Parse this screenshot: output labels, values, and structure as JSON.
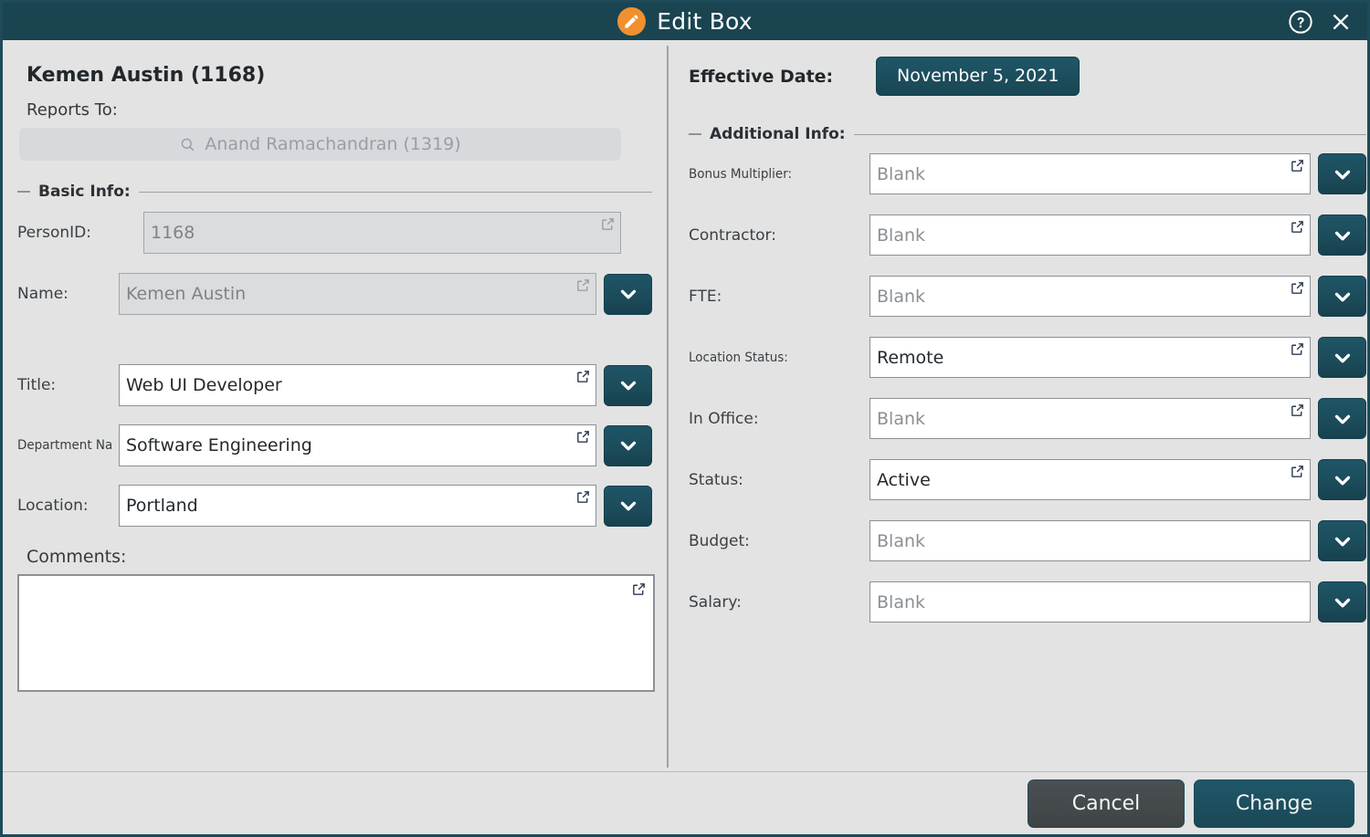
{
  "window": {
    "title": "Edit Box",
    "pencil_icon": "pencil-icon",
    "help_icon": "help-circle-icon",
    "close_icon": "close-icon",
    "accent_color": "#1a4450",
    "background_color": "#e3e3e3",
    "badge_color": "#f0902f"
  },
  "left": {
    "person_title": "Kemen Austin (1168)",
    "reports_to_label": "Reports To:",
    "reports_to_value": "Anand Ramachandran (1319)",
    "search_icon": "search-icon",
    "basic_info_header": "Basic Info:",
    "fields": [
      {
        "label": "PersonID:",
        "value": "1168",
        "disabled": true,
        "dropdown": false,
        "expand": true,
        "placeholder": false
      },
      {
        "label": "Name:",
        "value": "Kemen Austin",
        "disabled": true,
        "dropdown": true,
        "expand": true,
        "placeholder": false
      },
      {
        "label": "Title:",
        "value": "Web UI Developer",
        "disabled": false,
        "dropdown": true,
        "expand": true,
        "placeholder": false
      },
      {
        "label": "Department Name:",
        "value": "Software Engineering",
        "disabled": false,
        "dropdown": true,
        "expand": true,
        "placeholder": false
      },
      {
        "label": "Location:",
        "value": "Portland",
        "disabled": false,
        "dropdown": true,
        "expand": true,
        "placeholder": false
      }
    ],
    "comments_label": "Comments:",
    "comments_value": ""
  },
  "right": {
    "effective_date_label": "Effective Date:",
    "effective_date_value": "November 5, 2021",
    "additional_info_header": "Additional Info:",
    "fields": [
      {
        "label": "Bonus Multiplier:",
        "value": "Blank",
        "placeholder": true,
        "dropdown": true,
        "expand": true
      },
      {
        "label": "Contractor:",
        "value": "Blank",
        "placeholder": true,
        "dropdown": true,
        "expand": true
      },
      {
        "label": "FTE:",
        "value": "Blank",
        "placeholder": true,
        "dropdown": true,
        "expand": true
      },
      {
        "label": "Location Status:",
        "value": "Remote",
        "placeholder": false,
        "dropdown": true,
        "expand": true
      },
      {
        "label": "In Office:",
        "value": "Blank",
        "placeholder": true,
        "dropdown": true,
        "expand": true
      },
      {
        "label": "Status:",
        "value": "Active",
        "placeholder": false,
        "dropdown": true,
        "expand": true
      },
      {
        "label": "Budget:",
        "value": "Blank",
        "placeholder": true,
        "dropdown": true,
        "expand": false
      },
      {
        "label": "Salary:",
        "value": "Blank",
        "placeholder": true,
        "dropdown": true,
        "expand": false
      }
    ]
  },
  "footer": {
    "cancel_label": "Cancel",
    "change_label": "Change"
  }
}
